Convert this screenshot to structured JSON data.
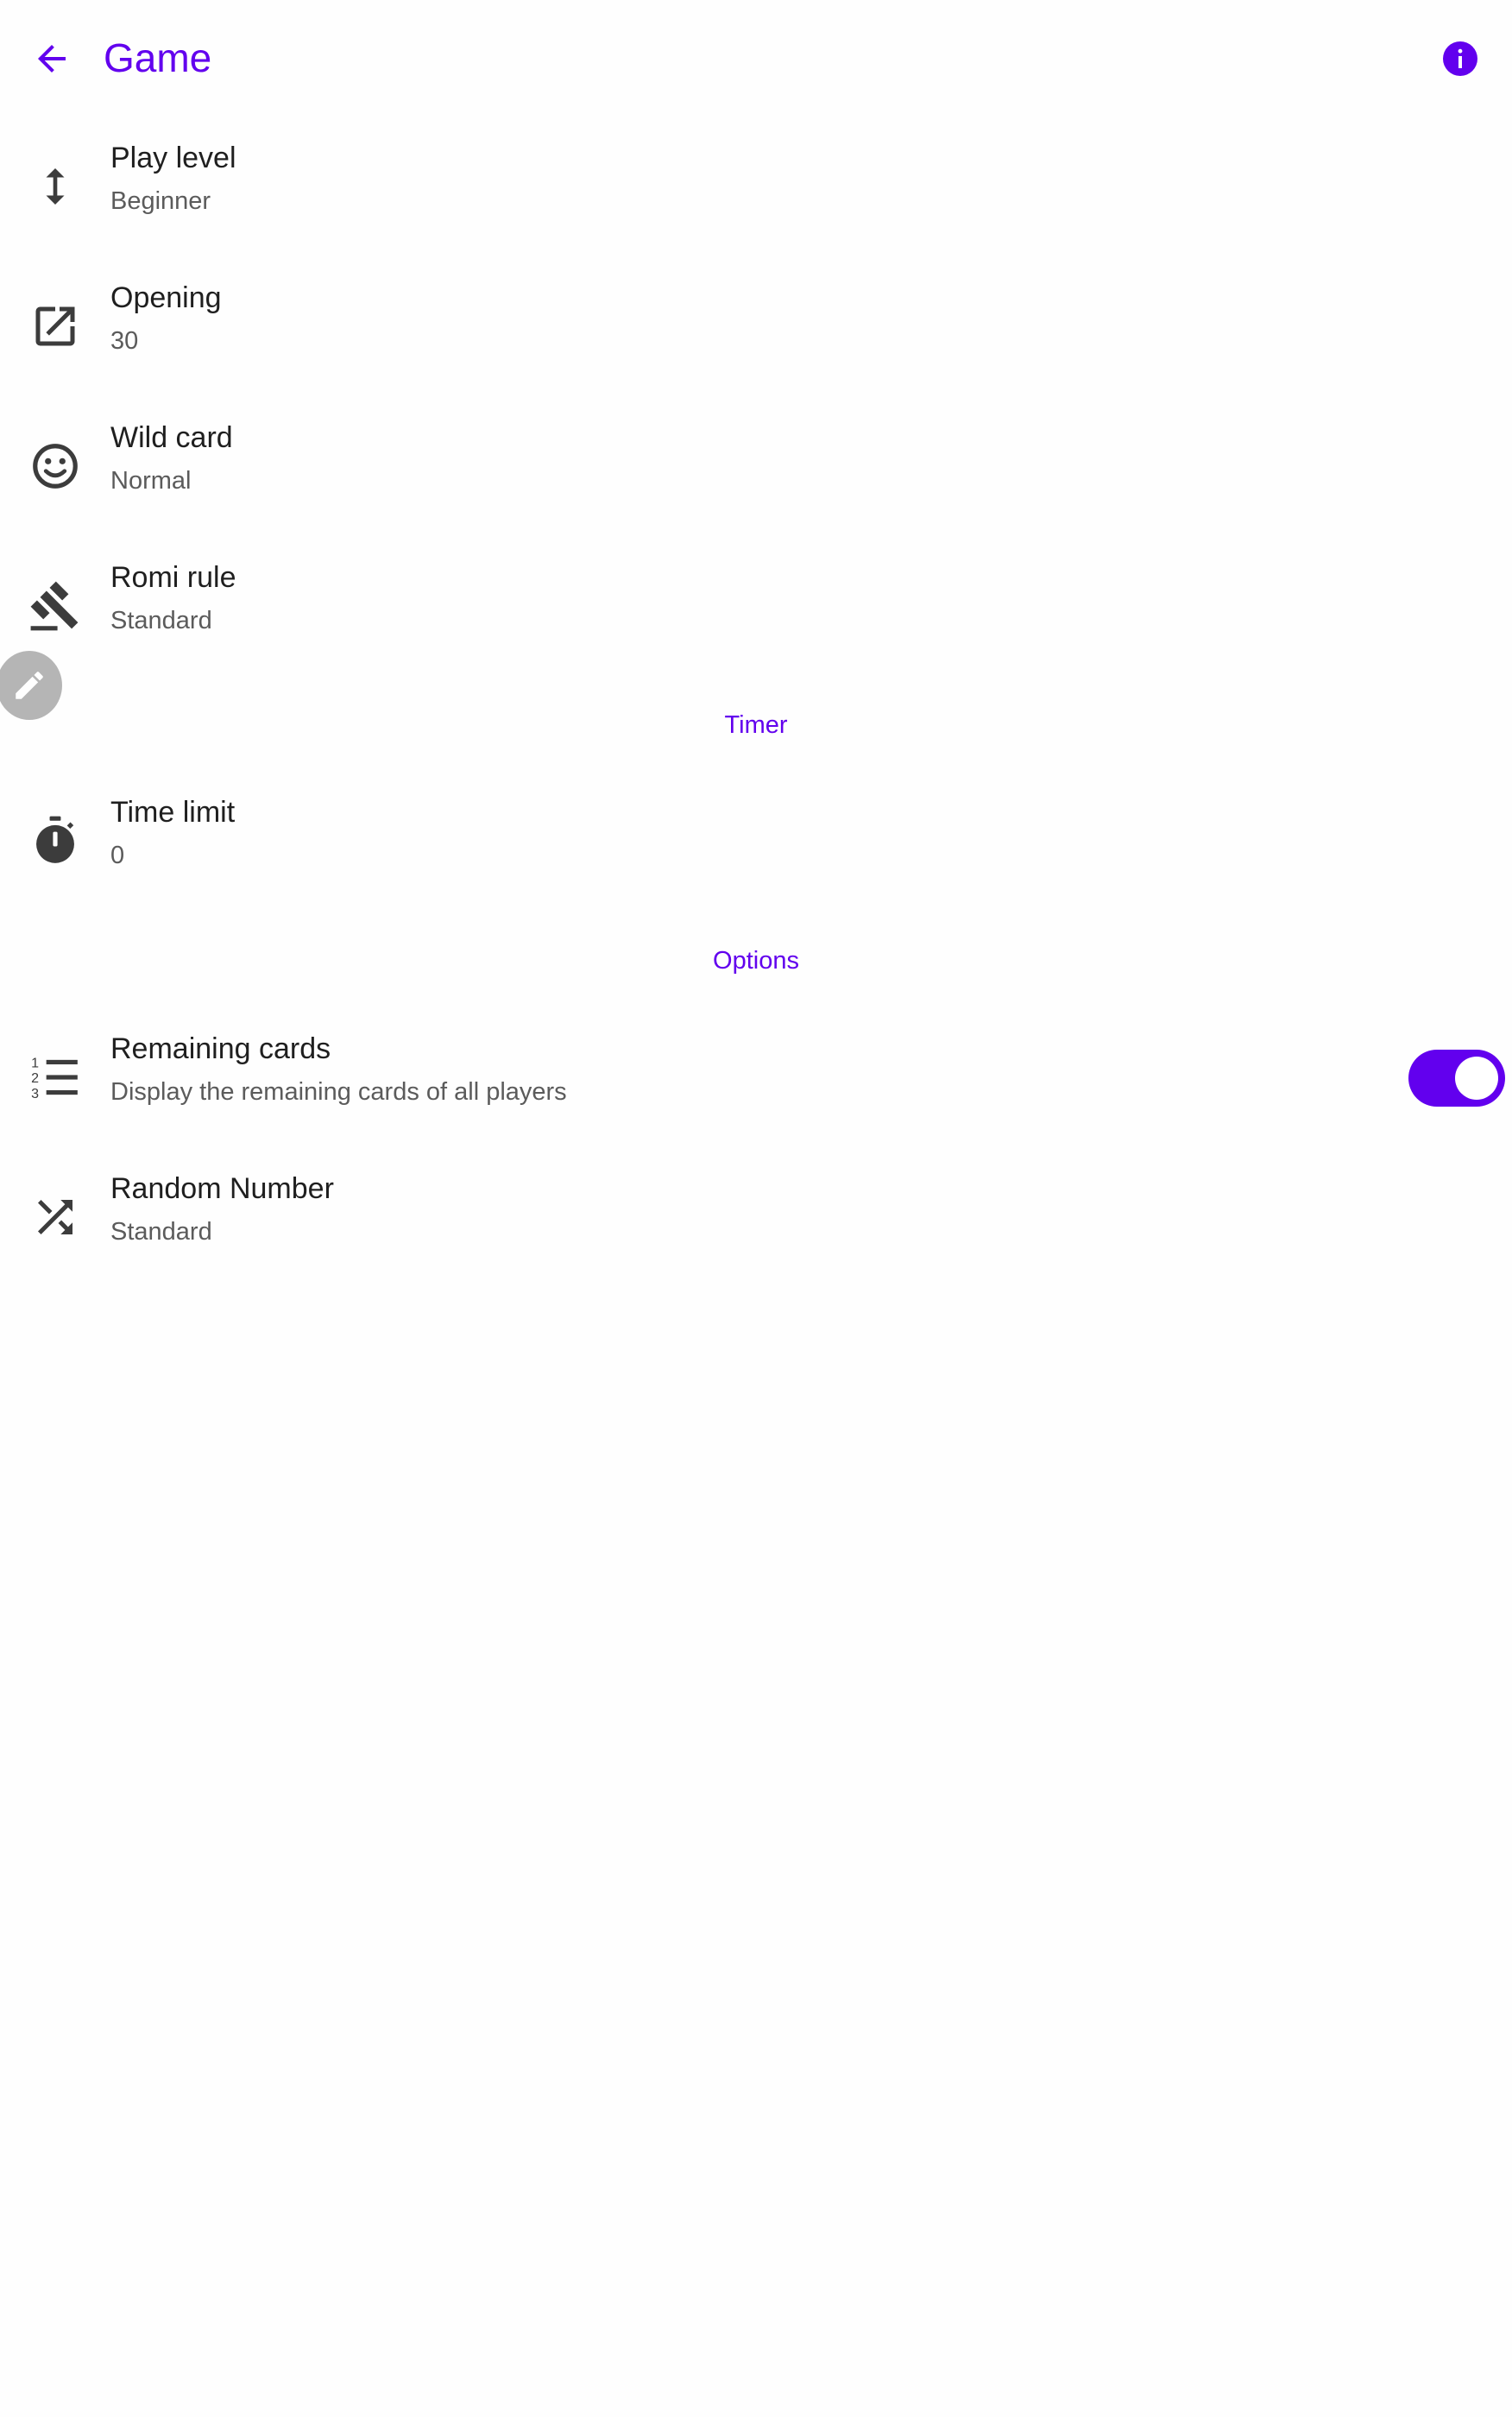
{
  "app_bar": {
    "title": "Game",
    "back_icon": "arrow-back-icon",
    "info_icon": "info-icon"
  },
  "settings": {
    "play_level": {
      "title": "Play level",
      "summary": "Beginner",
      "icon": "vertical-arrows-icon"
    },
    "opening": {
      "title": "Opening",
      "summary": "30",
      "icon": "open-in-new-icon"
    },
    "wild_card": {
      "title": "Wild card",
      "summary": "Normal",
      "icon": "smiley-icon"
    },
    "romi_rule": {
      "title": "Romi rule",
      "summary": "Standard",
      "icon": "gavel-icon"
    }
  },
  "timer": {
    "header": "Timer",
    "time_limit": {
      "title": "Time limit",
      "summary": "0",
      "icon": "timer-icon"
    }
  },
  "options": {
    "header": "Options",
    "remaining_cards": {
      "title": "Remaining cards",
      "summary": "Display the remaining cards of all players",
      "icon": "numbered-list-icon",
      "enabled": true
    },
    "random_number": {
      "title": "Random Number",
      "summary": "Standard",
      "icon": "shuffle-icon"
    }
  },
  "floating_edit": {
    "icon": "pencil-icon"
  },
  "colors": {
    "accent": "#6200ee",
    "title_text": "#1f1f1f",
    "summary_text": "#5b5b5b",
    "icon": "#3c3c3c",
    "background": "#fefefe"
  }
}
